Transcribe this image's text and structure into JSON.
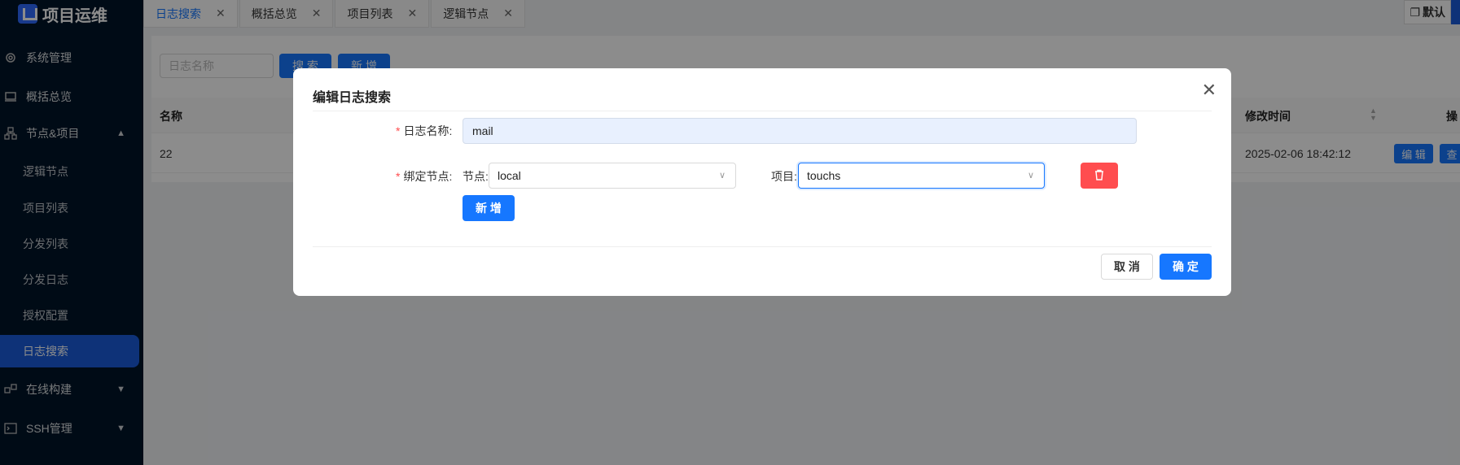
{
  "app": {
    "title": "项目运维"
  },
  "sidebar": {
    "items": [
      {
        "label": "系统管理",
        "icon": "gear-icon"
      },
      {
        "label": "概括总览",
        "icon": "laptop-icon"
      },
      {
        "label": "节点&项目",
        "icon": "cluster-icon",
        "expanded": true
      },
      {
        "label": "在线构建",
        "icon": "build-icon",
        "expanded": false
      },
      {
        "label": "SSH管理",
        "icon": "terminal-icon",
        "expanded": false
      }
    ],
    "sub_items": [
      {
        "label": "逻辑节点"
      },
      {
        "label": "项目列表"
      },
      {
        "label": "分发列表"
      },
      {
        "label": "分发日志"
      },
      {
        "label": "授权配置"
      },
      {
        "label": "日志搜索",
        "active": true
      }
    ]
  },
  "tabs": [
    {
      "label": "日志搜索",
      "active": true
    },
    {
      "label": "概括总览"
    },
    {
      "label": "项目列表"
    },
    {
      "label": "逻辑节点"
    }
  ],
  "toolbar": {
    "default_label": "默认"
  },
  "list": {
    "search_placeholder": "日志名称",
    "search_button": "搜 索",
    "add_button": "新 增",
    "columns": {
      "name": "名称",
      "modified": "修改时间",
      "actions": "操"
    },
    "rows": [
      {
        "name": "22",
        "modified": "2025-02-06 18:42:12",
        "edit": "编 辑",
        "view": "查"
      }
    ]
  },
  "modal": {
    "title": "编辑日志搜索",
    "name_label": "日志名称:",
    "name_value": "mail",
    "bind_label": "绑定节点:",
    "node_label": "节点:",
    "node_value": "local",
    "project_label": "项目:",
    "project_value": "touchs",
    "add_button": "新 增",
    "cancel_button": "取 消",
    "ok_button": "确 定"
  },
  "colors": {
    "sidebar_bg": "#001529",
    "primary": "#1677ff",
    "danger": "#ff4d4f",
    "active_menu": "#1a5cdb"
  }
}
